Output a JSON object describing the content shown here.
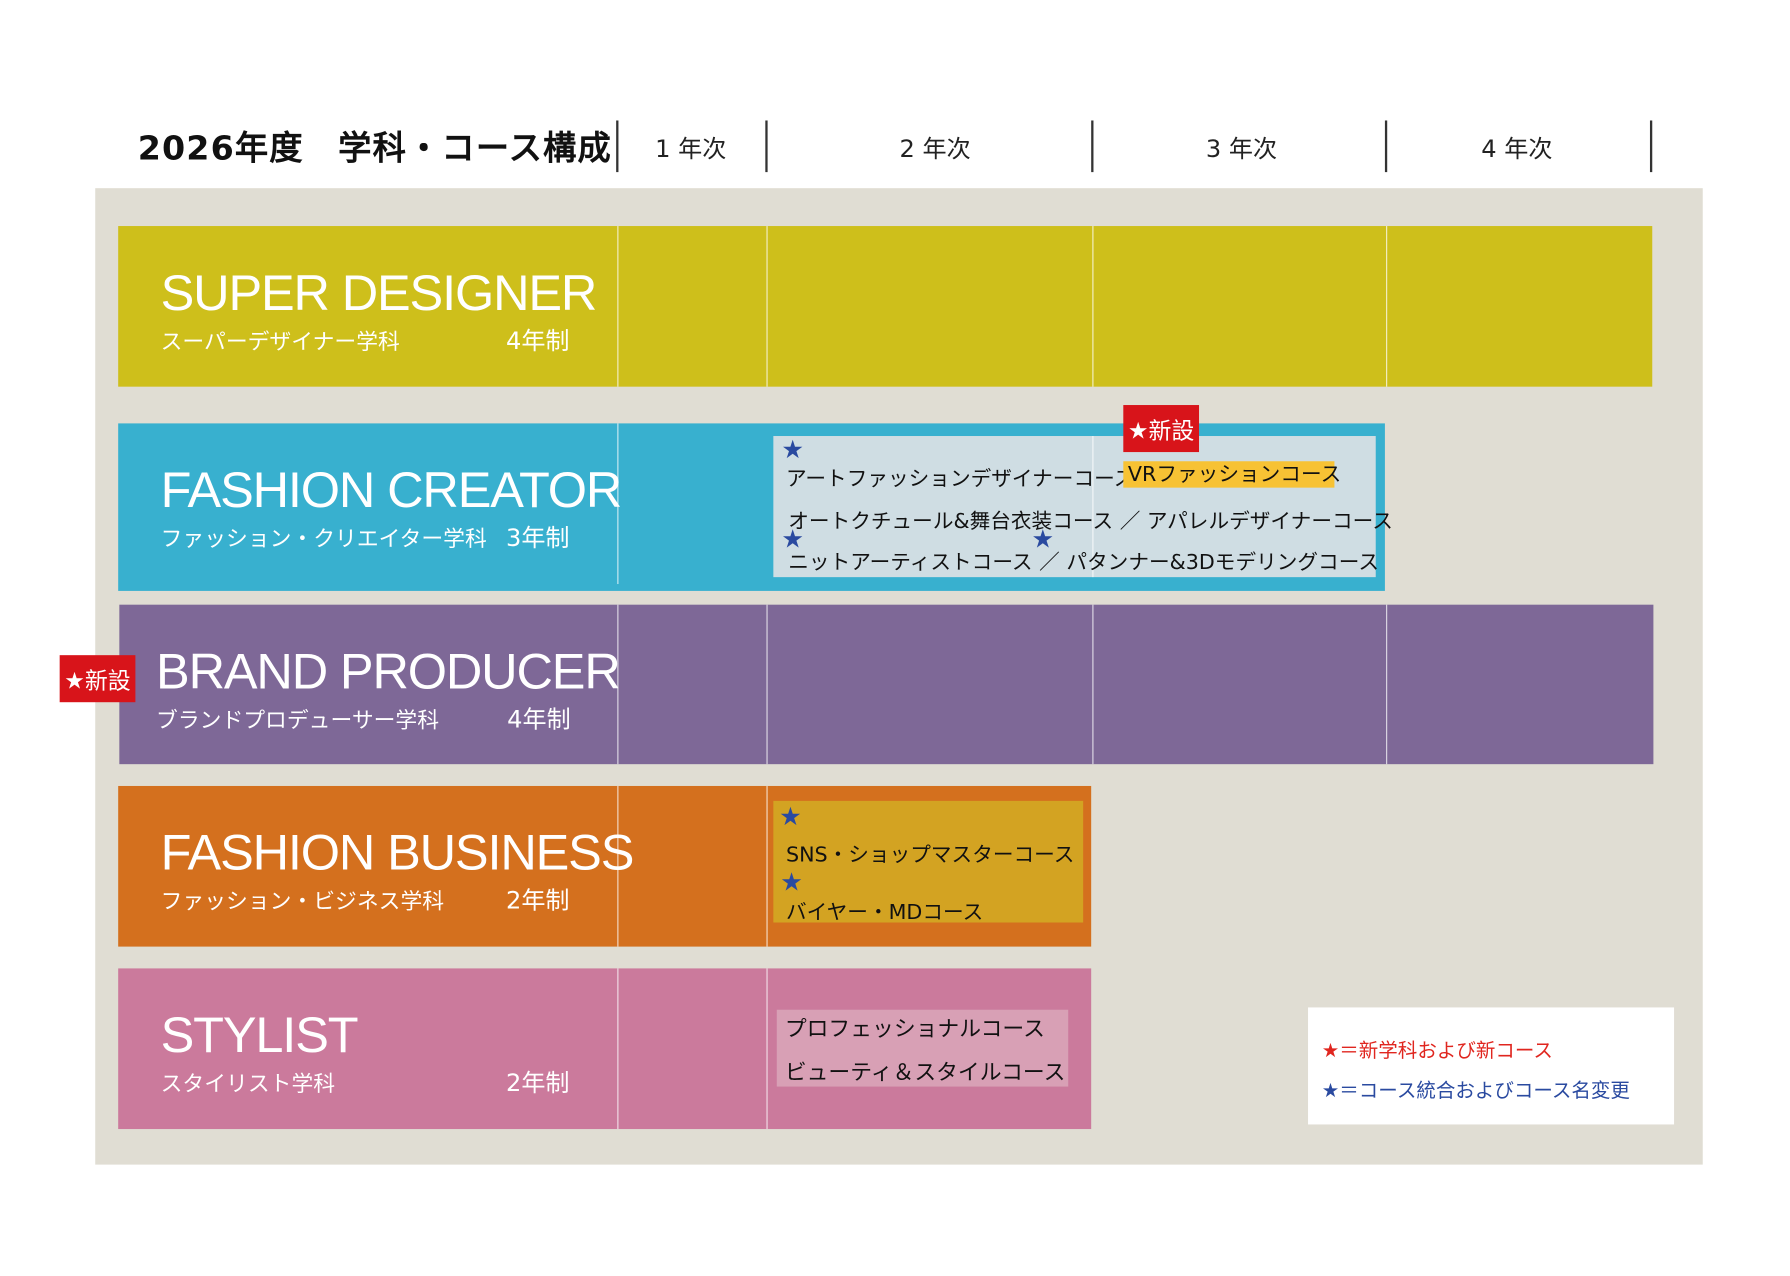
{
  "title": "2026年度　学科・コース構成",
  "years": [
    "1 年次",
    "2 年次",
    "3 年次",
    "4 年次"
  ],
  "departments": [
    {
      "en": "SUPER DESIGNER",
      "jp": "スーパーデザイナー学科",
      "years": "4年制",
      "color": "#cebf1b"
    },
    {
      "en": "FASHION CREATOR",
      "jp": "ファッション・クリエイター学科",
      "years": "3年制",
      "color": "#38b0cf"
    },
    {
      "en": "BRAND PRODUCER",
      "jp": "ブランドプロデューサー学科",
      "years": "4年制",
      "color": "#7e6897",
      "badge": "★新設"
    },
    {
      "en": "FASHION BUSINESS",
      "jp": "ファッション・ビジネス学科",
      "years": "2年制",
      "color": "#d4701e"
    },
    {
      "en": "STYLIST",
      "jp": "スタイリスト学科",
      "years": "2年制",
      "color": "#cb7a9c"
    }
  ],
  "fashion_creator_courses": {
    "badge": "★新設",
    "line1": "アートファッションデザイナーコース ／",
    "new_course": "VRファッションコース",
    "line2": "オートクチュール&舞台衣装コース ／ アパレルデザイナーコース",
    "line3": "ニットアーティストコース ／ パタンナー&3Dモデリングコース"
  },
  "fashion_business_courses": [
    "SNS・ショップマスターコース",
    "バイヤー・MDコース"
  ],
  "stylist_courses": [
    "プロフェッショナルコース",
    "ビューティ＆スタイルコース"
  ],
  "legend": {
    "red": "★＝新学科および新コース",
    "blue": "★＝コース統合およびコース名変更"
  },
  "star": "★",
  "colors": {
    "red": "#e0261f",
    "blue": "#2a4aa0",
    "highlight": "#f7c234"
  }
}
